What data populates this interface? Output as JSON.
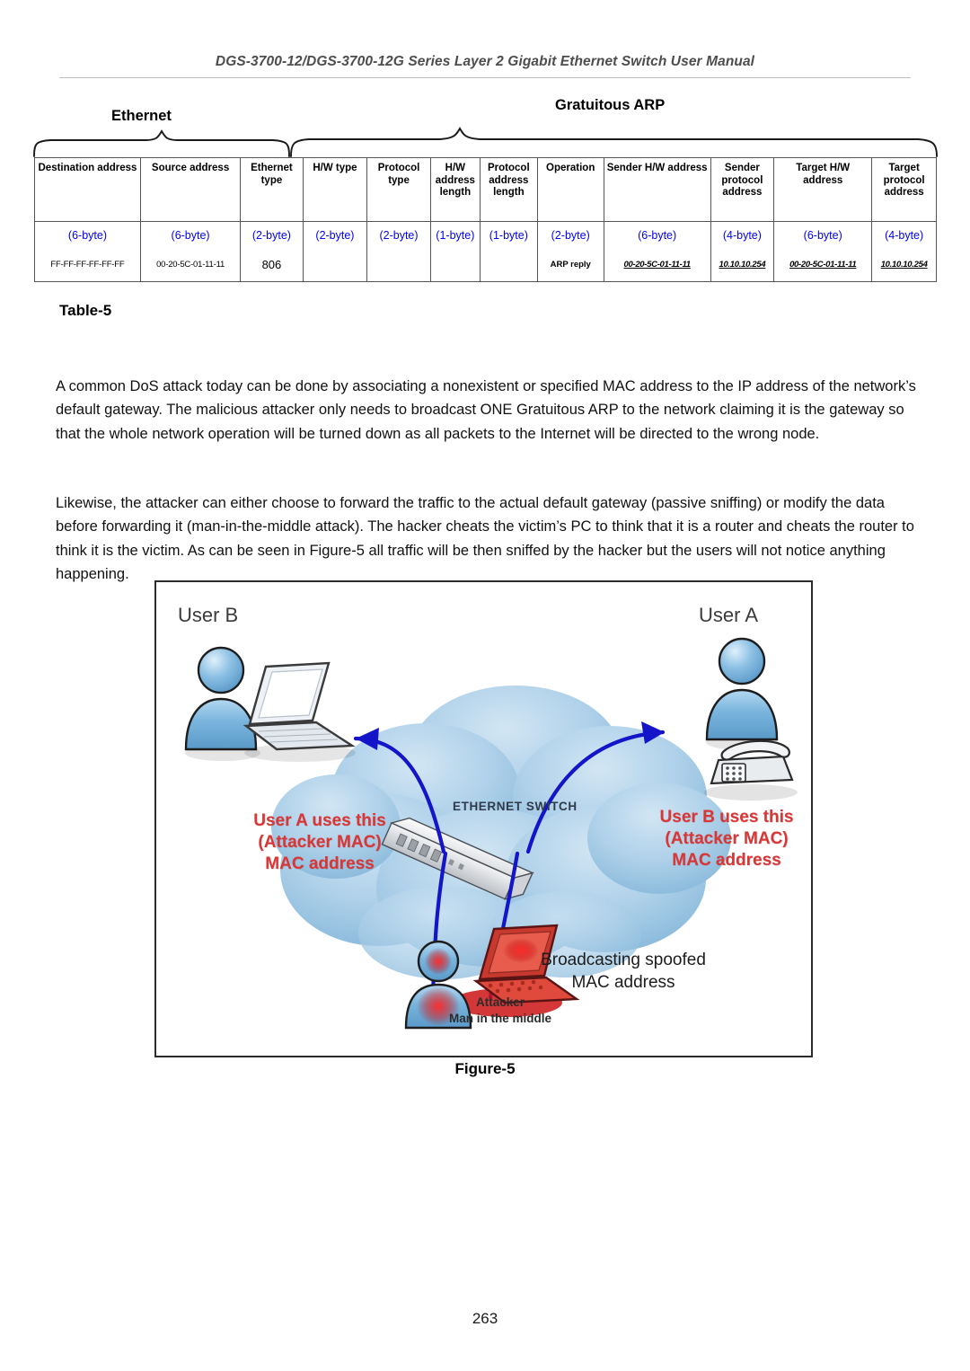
{
  "document": {
    "running_header": "DGS-3700-12/DGS-3700-12G Series Layer 2 Gigabit Ethernet Switch User Manual",
    "page_number": "263"
  },
  "table": {
    "caption": "Table-5",
    "groups": [
      {
        "label": "Ethernet",
        "span": 3
      },
      {
        "label": "Gratuitous ARP",
        "span": 10
      }
    ],
    "columns": [
      {
        "header": "Destination address",
        "size": "(6-byte)",
        "value": "FF-FF-FF-FF-FF-FF",
        "style": "plain"
      },
      {
        "header": "Source address",
        "size": "(6-byte)",
        "value": "00-20-5C-01-11-11",
        "style": "plain"
      },
      {
        "header": "Ethernet type",
        "size": "(2-byte)",
        "value": "806",
        "style": "num"
      },
      {
        "header": "H/W type",
        "size": "(2-byte)",
        "value": "",
        "style": "plain"
      },
      {
        "header": "Protocol type",
        "size": "(2-byte)",
        "value": "",
        "style": "plain"
      },
      {
        "header": "H/W address length",
        "size": "(1-byte)",
        "value": "",
        "style": "plain"
      },
      {
        "header": "Protocol address length",
        "size": "(1-byte)",
        "value": "",
        "style": "plain"
      },
      {
        "header": "Operation",
        "size": "(2-byte)",
        "value": "ARP reply",
        "style": "b"
      },
      {
        "header": "Sender H/W address",
        "size": "(6-byte)",
        "value": "00-20-5C-01-11-11",
        "style": "bi"
      },
      {
        "header": "Sender protocol address",
        "size": "(4-byte)",
        "value": "10.10.10.254",
        "style": "bi"
      },
      {
        "header": "Target H/W address",
        "size": "(6-byte)",
        "value": "00-20-5C-01-11-11",
        "style": "bi"
      },
      {
        "header": "Target protocol address",
        "size": "(4-byte)",
        "value": "10.10.10.254",
        "style": "bi"
      }
    ],
    "size_color": "#0000ff"
  },
  "body": {
    "paragraph_1": "A common DoS attack today can be done by associating a nonexistent or specified MAC address to the IP address of the network’s default gateway. The malicious attacker only needs to broadcast ONE Gratuitous ARP to the network claiming it is the gateway so that the whole network operation will be turned down as all packets to the Internet will be directed to the wrong node.",
    "paragraph_2": "Likewise, the attacker can either choose to forward the traffic to the actual default gateway (passive sniffing) or modify the data before forwarding it (man-in-the-middle attack). The hacker cheats the victim’s PC to think that it is a router and cheats the router to think it is the victim. As can be seen in Figure-5 all traffic will be then sniffed by the hacker but the users will not notice anything happening."
  },
  "figure": {
    "caption": "Figure-5",
    "user_b_label": "User B",
    "user_a_label": "User A",
    "annotation_left": "User A uses this\n(Attacker MAC)\nMAC address",
    "annotation_right": "User B uses this\n(Attacker MAC)\nMAC address",
    "switch_label": "ETHERNET SWITCH",
    "broadcast_label": "Broadcasting spoofed MAC address",
    "attacker_label": "Attacker\nMan in the middle",
    "colors": {
      "annotation_red": "#d93636",
      "cloud_blue": "#8fbfe0",
      "arrow_blue": "#1414c8",
      "attacker_red": "#e02020"
    }
  }
}
